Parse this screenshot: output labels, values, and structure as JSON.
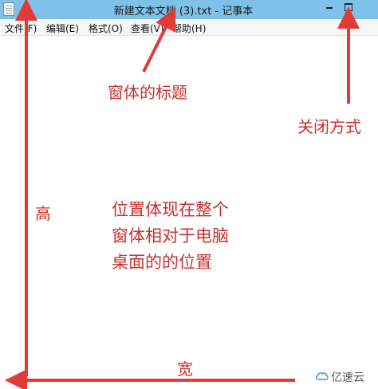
{
  "window": {
    "title": "新建文本文档 (3).txt - 记事本"
  },
  "menu": {
    "items": [
      {
        "label": "文件(F)"
      },
      {
        "label": "编辑(E)"
      },
      {
        "label": "格式(O)"
      },
      {
        "label": "查看(V)"
      },
      {
        "label": "帮助(H)"
      }
    ]
  },
  "annotations": {
    "title_label": "窗体的标题",
    "close_label": "关闭方式",
    "height_label": "高",
    "width_label": "宽",
    "position_lines": [
      "位置体现在整个",
      "窗体相对于电脑",
      "桌面的的位置"
    ]
  },
  "watermark": {
    "text": "亿速云"
  },
  "colors": {
    "titlebar": "#7fc1e9",
    "annotation": "#c8312f",
    "background": "#ffffff"
  }
}
